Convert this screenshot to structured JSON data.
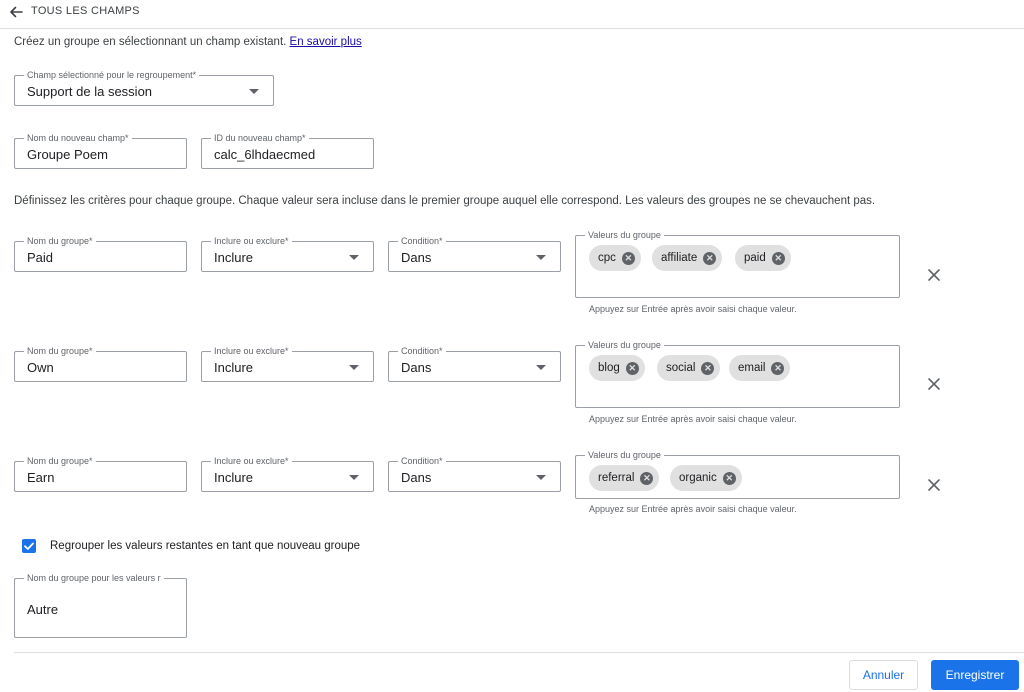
{
  "header": {
    "back_label": "TOUS LES CHAMPS"
  },
  "intro": {
    "text": "Créez un groupe en sélectionnant un champ existant.",
    "link": "En savoir plus"
  },
  "grouping_field": {
    "label": "Champ sélectionné pour le regroupement*",
    "value": "Support de la session"
  },
  "new_field_name": {
    "label": "Nom du nouveau champ*",
    "value": "Groupe Poem"
  },
  "new_field_id": {
    "label": "ID du nouveau champ*",
    "value": "calc_6lhdaecmed"
  },
  "criteria_text": "Définissez les critères pour chaque groupe. Chaque valeur sera incluse dans le premier groupe auquel elle correspond. Les valeurs des groupes ne se chevauchent pas.",
  "labels": {
    "group_name": "Nom du groupe*",
    "include_exclude": "Inclure ou exclure*",
    "condition": "Condition*",
    "group_values": "Valeurs du groupe",
    "helper": "Appuyez sur Entrée après avoir saisi chaque valeur."
  },
  "groups": [
    {
      "name": "Paid",
      "include": "Inclure",
      "condition": "Dans",
      "values": [
        "cpc",
        "affiliate",
        "paid"
      ]
    },
    {
      "name": "Own",
      "include": "Inclure",
      "condition": "Dans",
      "values": [
        "blog",
        "social",
        "email"
      ]
    },
    {
      "name": "Earn",
      "include": "Inclure",
      "condition": "Dans",
      "values": [
        "referral",
        "organic"
      ]
    }
  ],
  "remaining": {
    "checkbox_label": "Regrouper les valeurs restantes en tant que nouveau groupe",
    "checked": true,
    "field_label": "Nom du groupe pour les valeurs r",
    "field_value": "Autre"
  },
  "footer": {
    "cancel": "Annuler",
    "save": "Enregistrer"
  },
  "colors": {
    "primary": "#1a73e8",
    "chip": "#e0e0e0"
  }
}
